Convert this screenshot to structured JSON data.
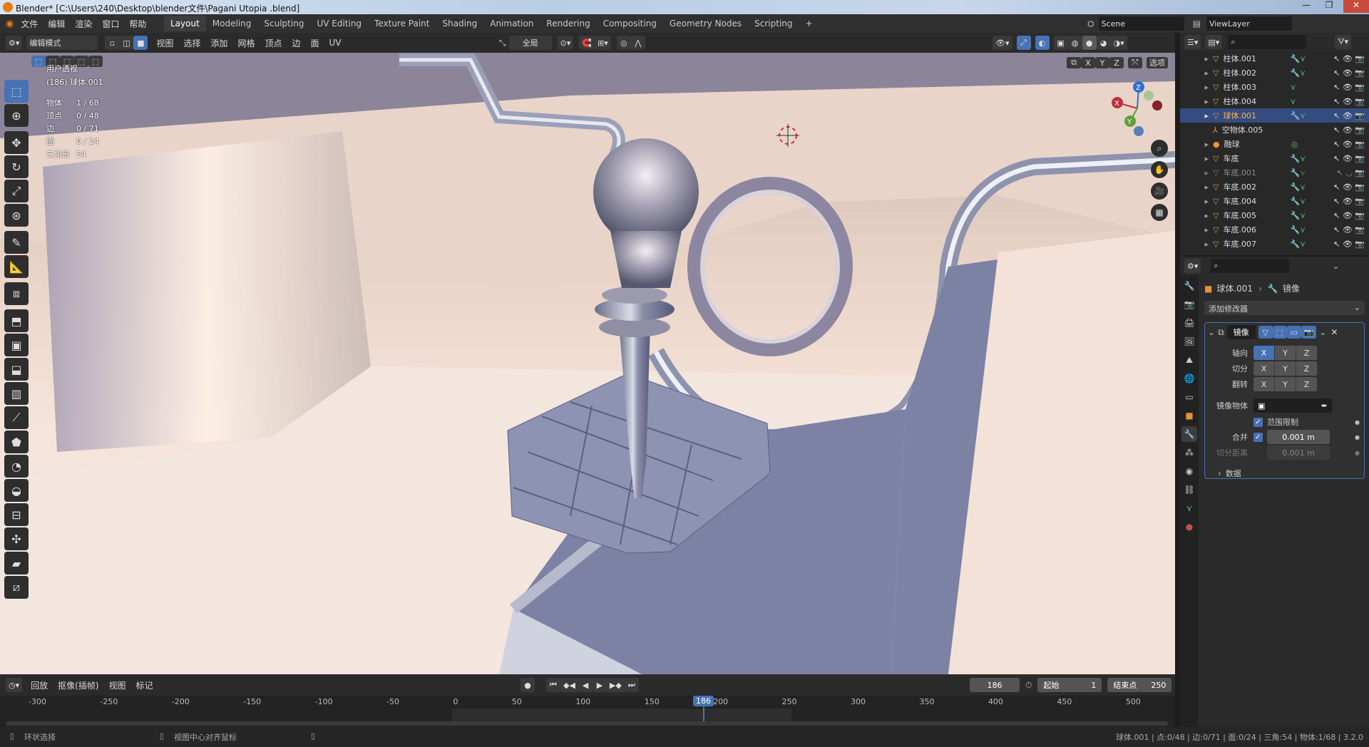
{
  "title_bar": {
    "title": "Blender* [C:\\Users\\240\\Desktop\\blender文件\\Pagani Utopia .blend]",
    "min": "—",
    "max": "❐",
    "close": "✕"
  },
  "menu": {
    "items": [
      "文件",
      "编辑",
      "渲染",
      "窗口",
      "帮助"
    ],
    "workspaces": [
      "Layout",
      "Modeling",
      "Sculpting",
      "UV Editing",
      "Texture Paint",
      "Shading",
      "Animation",
      "Rendering",
      "Compositing",
      "Geometry Nodes",
      "Scripting"
    ],
    "add_tab": "+",
    "scene": "Scene",
    "view_layer": "ViewLayer"
  },
  "viewport_header": {
    "mode": "编辑模式",
    "menus": [
      "视图",
      "选择",
      "添加",
      "网格",
      "顶点",
      "边",
      "面",
      "UV"
    ],
    "transform_orientation": "全局",
    "axis_x": "X",
    "axis_y": "Y",
    "axis_z": "Z",
    "options": "选项"
  },
  "viewport_overlay": {
    "view_name": "用户透视",
    "object_line": "(186) 球体.001",
    "stats": [
      {
        "label": "物体",
        "value": "1 / 68"
      },
      {
        "label": "顶点",
        "value": "0 / 48"
      },
      {
        "label": "边",
        "value": "0 / 71"
      },
      {
        "label": "面",
        "value": "0 / 24"
      },
      {
        "label": "三角形",
        "value": "54"
      }
    ]
  },
  "gizmo": {
    "x": "X",
    "y": "Y",
    "z": "Z"
  },
  "toolbar": {
    "tools": [
      "select-box",
      "cursor",
      "move",
      "rotate",
      "scale",
      "transform",
      "annotate",
      "measure",
      "add-cube",
      "extrude",
      "inset",
      "bevel",
      "loop-cut",
      "knife",
      "poly-build",
      "spin",
      "smooth",
      "edge-slide",
      "shrink",
      "shear",
      "rip"
    ]
  },
  "timeline": {
    "playback": "回放",
    "keying": "抠像(插帧)",
    "view": "视图",
    "marker": "标记",
    "current_frame": "186",
    "start_label": "起始",
    "start": "1",
    "end_label": "结束点",
    "end": "250",
    "ticks": [
      "-300",
      "-250",
      "-200",
      "-150",
      "-100",
      "-50",
      "0",
      "50",
      "100",
      "150",
      "200",
      "250",
      "300",
      "350",
      "400",
      "450",
      "500"
    ],
    "playhead": "186"
  },
  "status_bar": {
    "left": "环状选择",
    "middle": "视图中心对齐鼠标",
    "right": "球体.001 | 点:0/48 | 边:0/71 | 面:0/24 | 三角:54 | 物体:1/68 | 3.2.0"
  },
  "outliner": {
    "items": [
      {
        "name": "柱体.001",
        "state": "normal"
      },
      {
        "name": "柱体.002",
        "state": "normal"
      },
      {
        "name": "柱体.003",
        "state": "normal"
      },
      {
        "name": "柱体.004",
        "state": "normal"
      },
      {
        "name": "球体.001",
        "state": "selected"
      },
      {
        "name": "空物体.005",
        "state": "normal"
      },
      {
        "name": "融球",
        "state": "normal"
      },
      {
        "name": "车底",
        "state": "normal"
      },
      {
        "name": "车底.001",
        "state": "dim"
      },
      {
        "name": "车底.002",
        "state": "normal"
      },
      {
        "name": "车底.004",
        "state": "normal"
      },
      {
        "name": "车底.005",
        "state": "normal"
      },
      {
        "name": "车底.006",
        "state": "normal"
      },
      {
        "name": "车底.007",
        "state": "normal"
      }
    ]
  },
  "properties": {
    "object_name": "球体.001",
    "modifier_label": "镜像",
    "add_modifier": "添加修改器",
    "modifier_name": "镜像",
    "axis_label": "轴向",
    "bisect_label": "切分",
    "flip_label": "翻转",
    "mirror_object_label": "镜像物体",
    "clipping_label": "范围限制",
    "merge_label": "合并",
    "merge_value": "0.001 m",
    "bisect_distance_label": "切分距离",
    "bisect_distance_value": "0.001 m",
    "data_label": "数据"
  },
  "colors": {
    "accent": "#4772b3",
    "selected_row": "#334d80",
    "object_orange": "#e8903a",
    "modifier_blue": "#5c9ee0",
    "data_green": "#56c56a"
  }
}
